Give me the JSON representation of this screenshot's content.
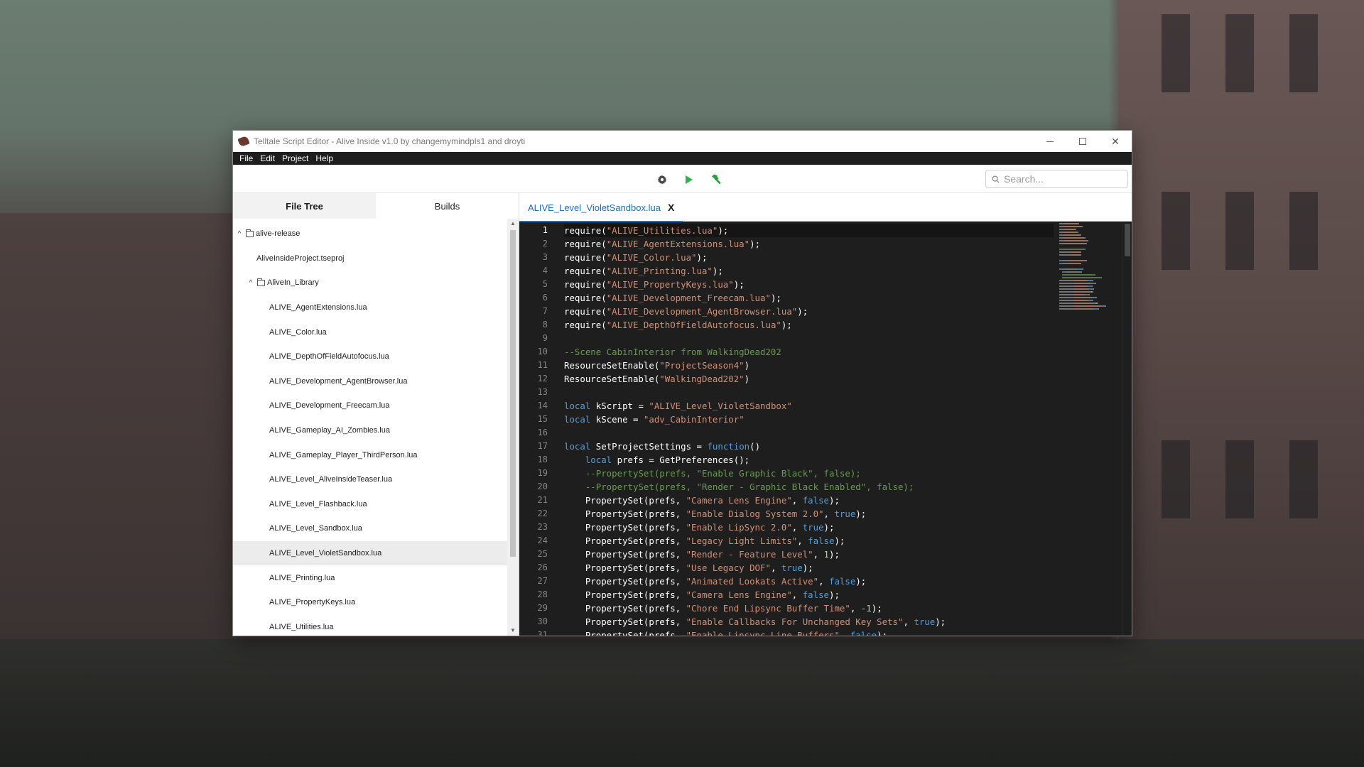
{
  "window": {
    "title": "Telltale Script Editor - Alive Inside v1.0 by changemymindpls1 and droyti",
    "minimize": "—",
    "maximize": "☐",
    "close": "✕"
  },
  "menu": [
    "File",
    "Edit",
    "Project",
    "Help"
  ],
  "toolbar": {
    "settings_icon": "gear-icon",
    "run_icon": "play-icon",
    "build_icon": "hammer-icon",
    "search_placeholder": "Search..."
  },
  "sidebar": {
    "tabs": [
      "File Tree",
      "Builds"
    ],
    "active_tab": "File Tree",
    "tree": [
      {
        "label": "alive-release",
        "type": "folder",
        "expanded": true,
        "level": 0
      },
      {
        "label": "AliveInsideProject.tseproj",
        "type": "file",
        "level": 1
      },
      {
        "label": "AliveIn_Library",
        "type": "folder",
        "expanded": true,
        "level": 1
      },
      {
        "label": "ALIVE_AgentExtensions.lua",
        "type": "file",
        "level": 2
      },
      {
        "label": "ALIVE_Color.lua",
        "type": "file",
        "level": 2
      },
      {
        "label": "ALIVE_DepthOfFieldAutofocus.lua",
        "type": "file",
        "level": 2
      },
      {
        "label": "ALIVE_Development_AgentBrowser.lua",
        "type": "file",
        "level": 2
      },
      {
        "label": "ALIVE_Development_Freecam.lua",
        "type": "file",
        "level": 2
      },
      {
        "label": "ALIVE_Gameplay_AI_Zombies.lua",
        "type": "file",
        "level": 2
      },
      {
        "label": "ALIVE_Gameplay_Player_ThirdPerson.lua",
        "type": "file",
        "level": 2
      },
      {
        "label": "ALIVE_Level_AliveInsideTeaser.lua",
        "type": "file",
        "level": 2
      },
      {
        "label": "ALIVE_Level_Flashback.lua",
        "type": "file",
        "level": 2
      },
      {
        "label": "ALIVE_Level_Sandbox.lua",
        "type": "file",
        "level": 2
      },
      {
        "label": "ALIVE_Level_VioletSandbox.lua",
        "type": "file",
        "level": 2,
        "selected": true
      },
      {
        "label": "ALIVE_Printing.lua",
        "type": "file",
        "level": 2
      },
      {
        "label": "ALIVE_PropertyKeys.lua",
        "type": "file",
        "level": 2
      },
      {
        "label": "ALIVE_Utilities.lua",
        "type": "file",
        "level": 2
      }
    ]
  },
  "editor": {
    "open_tab": "ALIVE_Level_VioletSandbox.lua",
    "close_glyph": "X",
    "current_line": 1,
    "lines": [
      [
        [
          "t",
          "require("
        ],
        [
          "s",
          "\"ALIVE_Utilities.lua\""
        ],
        [
          "t",
          ");"
        ]
      ],
      [
        [
          "t",
          "require("
        ],
        [
          "s",
          "\"ALIVE_AgentExtensions.lua\""
        ],
        [
          "t",
          ");"
        ]
      ],
      [
        [
          "t",
          "require("
        ],
        [
          "s",
          "\"ALIVE_Color.lua\""
        ],
        [
          "t",
          ");"
        ]
      ],
      [
        [
          "t",
          "require("
        ],
        [
          "s",
          "\"ALIVE_Printing.lua\""
        ],
        [
          "t",
          ");"
        ]
      ],
      [
        [
          "t",
          "require("
        ],
        [
          "s",
          "\"ALIVE_PropertyKeys.lua\""
        ],
        [
          "t",
          ");"
        ]
      ],
      [
        [
          "t",
          "require("
        ],
        [
          "s",
          "\"ALIVE_Development_Freecam.lua\""
        ],
        [
          "t",
          ");"
        ]
      ],
      [
        [
          "t",
          "require("
        ],
        [
          "s",
          "\"ALIVE_Development_AgentBrowser.lua\""
        ],
        [
          "t",
          ");"
        ]
      ],
      [
        [
          "t",
          "require("
        ],
        [
          "s",
          "\"ALIVE_DepthOfFieldAutofocus.lua\""
        ],
        [
          "t",
          ");"
        ]
      ],
      [],
      [
        [
          "c",
          "--Scene CabinInterior from WalkingDead202"
        ]
      ],
      [
        [
          "t",
          "ResourceSetEnable("
        ],
        [
          "s",
          "\"ProjectSeason4\""
        ],
        [
          "t",
          ")"
        ]
      ],
      [
        [
          "t",
          "ResourceSetEnable("
        ],
        [
          "s",
          "\"WalkingDead202\""
        ],
        [
          "t",
          ")"
        ]
      ],
      [],
      [
        [
          "k",
          "local"
        ],
        [
          "t",
          " kScript = "
        ],
        [
          "s",
          "\"ALIVE_Level_VioletSandbox\""
        ]
      ],
      [
        [
          "k",
          "local"
        ],
        [
          "t",
          " kScene = "
        ],
        [
          "s",
          "\"adv_CabinInterior\""
        ]
      ],
      [],
      [
        [
          "k",
          "local"
        ],
        [
          "t",
          " SetProjectSettings = "
        ],
        [
          "k",
          "function"
        ],
        [
          "t",
          "()"
        ]
      ],
      [
        [
          "t",
          "    "
        ],
        [
          "k",
          "local"
        ],
        [
          "t",
          " prefs = GetPreferences();"
        ]
      ],
      [
        [
          "t",
          "    "
        ],
        [
          "c",
          "--PropertySet(prefs, \"Enable Graphic Black\", false);"
        ]
      ],
      [
        [
          "t",
          "    "
        ],
        [
          "c",
          "--PropertySet(prefs, \"Render - Graphic Black Enabled\", false);"
        ]
      ],
      [
        [
          "t",
          "    PropertySet(prefs, "
        ],
        [
          "s",
          "\"Camera Lens Engine\""
        ],
        [
          "t",
          ", "
        ],
        [
          "k",
          "false"
        ],
        [
          "t",
          ");"
        ]
      ],
      [
        [
          "t",
          "    PropertySet(prefs, "
        ],
        [
          "s",
          "\"Enable Dialog System 2.0\""
        ],
        [
          "t",
          ", "
        ],
        [
          "k",
          "true"
        ],
        [
          "t",
          ");"
        ]
      ],
      [
        [
          "t",
          "    PropertySet(prefs, "
        ],
        [
          "s",
          "\"Enable LipSync 2.0\""
        ],
        [
          "t",
          ", "
        ],
        [
          "k",
          "true"
        ],
        [
          "t",
          ");"
        ]
      ],
      [
        [
          "t",
          "    PropertySet(prefs, "
        ],
        [
          "s",
          "\"Legacy Light Limits\""
        ],
        [
          "t",
          ", "
        ],
        [
          "k",
          "false"
        ],
        [
          "t",
          ");"
        ]
      ],
      [
        [
          "t",
          "    PropertySet(prefs, "
        ],
        [
          "s",
          "\"Render - Feature Level\""
        ],
        [
          "t",
          ", "
        ],
        [
          "n",
          "1"
        ],
        [
          "t",
          ");"
        ]
      ],
      [
        [
          "t",
          "    PropertySet(prefs, "
        ],
        [
          "s",
          "\"Use Legacy DOF\""
        ],
        [
          "t",
          ", "
        ],
        [
          "k",
          "true"
        ],
        [
          "t",
          ");"
        ]
      ],
      [
        [
          "t",
          "    PropertySet(prefs, "
        ],
        [
          "s",
          "\"Animated Lookats Active\""
        ],
        [
          "t",
          ", "
        ],
        [
          "k",
          "false"
        ],
        [
          "t",
          ");"
        ]
      ],
      [
        [
          "t",
          "    PropertySet(prefs, "
        ],
        [
          "s",
          "\"Camera Lens Engine\""
        ],
        [
          "t",
          ", "
        ],
        [
          "k",
          "false"
        ],
        [
          "t",
          ");"
        ]
      ],
      [
        [
          "t",
          "    PropertySet(prefs, "
        ],
        [
          "s",
          "\"Chore End Lipsync Buffer Time\""
        ],
        [
          "t",
          ", "
        ],
        [
          "n",
          "-1"
        ],
        [
          "t",
          ");"
        ]
      ],
      [
        [
          "t",
          "    PropertySet(prefs, "
        ],
        [
          "s",
          "\"Enable Callbacks For Unchanged Key Sets\""
        ],
        [
          "t",
          ", "
        ],
        [
          "k",
          "true"
        ],
        [
          "t",
          ");"
        ]
      ],
      [
        [
          "t",
          "    PropertySet(prefs, "
        ],
        [
          "s",
          "\"Enable Lipsync Line Buffers\""
        ],
        [
          "t",
          ", "
        ],
        [
          "k",
          "false"
        ],
        [
          "t",
          ");"
        ]
      ]
    ]
  },
  "colors": {
    "string": "#ce9178",
    "keyword": "#569cd6",
    "comment": "#6a9955",
    "number": "#b5cea8",
    "accent": "#1a6ec2",
    "run_green": "#2db34a",
    "build_green": "#2a9d3a"
  }
}
